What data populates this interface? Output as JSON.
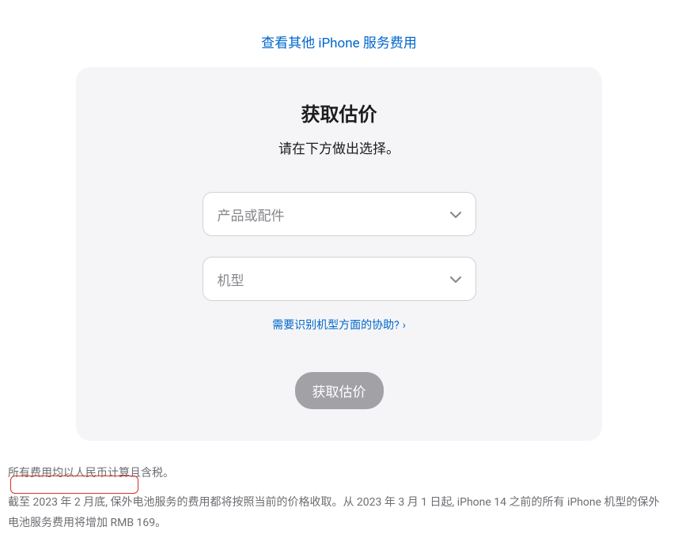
{
  "top_link": {
    "label": "查看其他 iPhone 服务费用"
  },
  "card": {
    "title": "获取估价",
    "subtitle": "请在下方做出选择。",
    "select_product": {
      "placeholder": "产品或配件"
    },
    "select_model": {
      "placeholder": "机型"
    },
    "help_link": {
      "label": "需要识别机型方面的协助?"
    },
    "button": {
      "label": "获取估价"
    }
  },
  "footnotes": {
    "line1": "所有费用均以人民币计算且含税。",
    "line2": "截至 2023 年 2 月底, 保外电池服务的费用都将按照当前的价格收取。从 2023 年 3 月 1 日起, iPhone 14 之前的所有 iPhone 机型的保外电池服务费用将增加 RMB 169。"
  }
}
